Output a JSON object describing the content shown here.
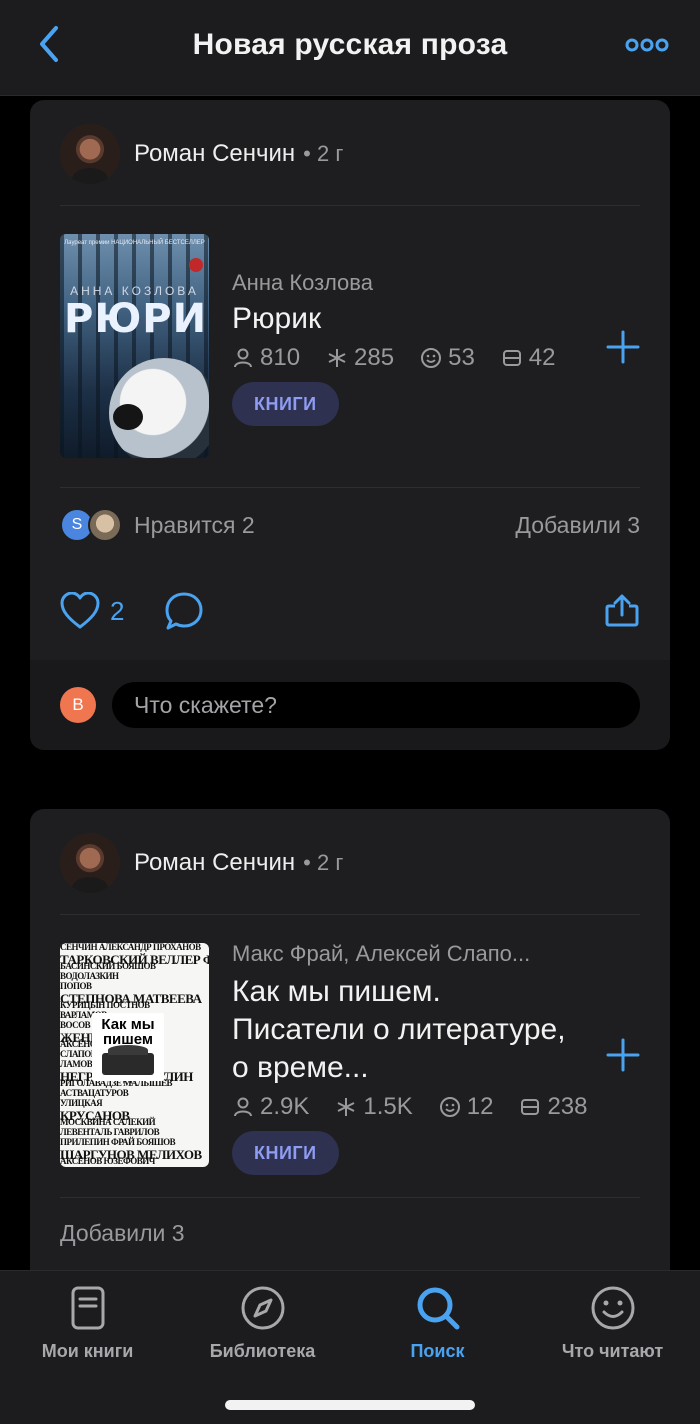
{
  "header": {
    "title": "Новая русская проза",
    "back_icon": "chevron-left-icon",
    "more_icon": "ellipsis-icon",
    "accent": "#4aa3f0"
  },
  "posts": [
    {
      "author": "Роман Сенчин",
      "time": "• 2 г",
      "book": {
        "author": "Анна Козлова",
        "title": "Рюрик",
        "cover": {
          "top": "Лауреат премии НАЦИОНАЛЬНЫЙ БЕСТСЕЛЛЕР",
          "author": "АННА КОЗЛОВА",
          "title": "РЮРИК"
        },
        "stats": {
          "readers": "810",
          "quotes": "285",
          "impressions": "53",
          "shelves": "42"
        },
        "tag": "КНИГИ"
      },
      "likes_text": "Нравится 2",
      "like_avatar_letter": "S",
      "added_text": "Добавили 3",
      "like_count": "2",
      "comment": {
        "avatar_letter": "B",
        "placeholder": "Что скажете?"
      }
    },
    {
      "author": "Роман Сенчин",
      "time": "• 2 г",
      "book": {
        "author": "Макс Фрай, Алексей Слапо...",
        "title": "Как мы пишем. Писатели о литературе, о време...",
        "cover": {
          "plate_title": "Как мы пишем",
          "names": [
            "СЕНЧИН АЛЕКСАНДР ПРОХАНОВ",
            "ТАРКОВСКИЙ ВЕЛЛЕР ФРАЙ",
            "БАСИНСКИЙ БОЯШОВ",
            "ВОДОЛАЗКИН",
            "ПОПОВ",
            "СТЕПНОВА МАТВЕЕВА",
            "КУРИЦЫН ПОСТНОВ",
            "ВАРЛАМОВ",
            "ВОСОВ ГУБАНОВ",
            "ЖЕНКО",
            "АКСЁНОВ ВОЛОВИКИ",
            "СЛАПОВСКИЙ",
            "ЛАМОВ ЕТОЕВ",
            "НЕГРИВ ИДИАТУЛИН",
            "РИГОЛАВАДЗЕ МАЛЫШЕВ",
            "АСТВАЦАТУРОВ",
            "УЛИЦКАЯ",
            "КРУСАНОВ",
            "МОСКВИНА САЛЕКИЙ",
            "ЛЕВЕНТАЛЬ ГАВРИЛОВ",
            "ПРИЛЕПИН ФРАЙ БОЯШОВ",
            "ШАРГУНОВ МЕЛИХОВ",
            "АКСЁНОВ ЮЗЕФОВИЧ"
          ]
        },
        "stats": {
          "readers": "2.9K",
          "quotes": "1.5K",
          "impressions": "12",
          "shelves": "238"
        },
        "tag": "КНИГИ"
      },
      "added_text": "Добавили 3"
    }
  ],
  "tabbar": {
    "tabs": [
      {
        "label": "Мои книги",
        "icon": "book-icon",
        "active": false
      },
      {
        "label": "Библиотека",
        "icon": "compass-icon",
        "active": false
      },
      {
        "label": "Поиск",
        "icon": "search-icon",
        "active": true
      },
      {
        "label": "Что читают",
        "icon": "smiley-icon",
        "active": false
      }
    ]
  }
}
